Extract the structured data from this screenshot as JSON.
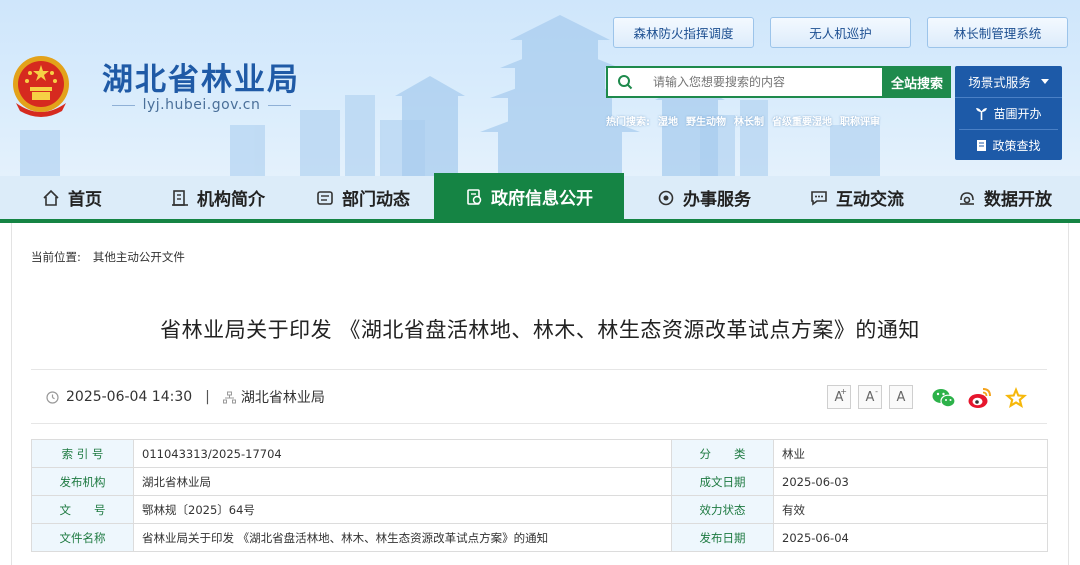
{
  "site": {
    "title": "湖北省林业局",
    "domain": "lyj.hubei.gov.cn"
  },
  "top_links": [
    "森林防火指挥调度",
    "无人机巡护",
    "林长制管理系统"
  ],
  "search": {
    "placeholder": "请输入您想要搜索的内容",
    "button": "全站搜索",
    "hot_label": "热门搜索:",
    "hot_terms": [
      "湿地",
      "野生动物",
      "林长制",
      "省级重要湿地",
      "职称评审"
    ]
  },
  "scene_service": {
    "label": "场景式服务",
    "items": [
      {
        "label": "苗圃开办",
        "icon": "seedling-icon"
      },
      {
        "label": "政策查找",
        "icon": "document-icon"
      }
    ]
  },
  "nav": {
    "items": [
      {
        "label": "首页",
        "icon": "home-icon",
        "active": false
      },
      {
        "label": "机构简介",
        "icon": "building-icon",
        "active": false
      },
      {
        "label": "部门动态",
        "icon": "news-icon",
        "active": false
      },
      {
        "label": "政府信息公开",
        "icon": "info-icon",
        "active": true
      },
      {
        "label": "办事服务",
        "icon": "service-icon",
        "active": false
      },
      {
        "label": "互动交流",
        "icon": "chat-icon",
        "active": false
      },
      {
        "label": "数据开放",
        "icon": "data-icon",
        "active": false
      }
    ]
  },
  "breadcrumb": {
    "label": "当前位置:",
    "path": "其他主动公开文件"
  },
  "article": {
    "title": "省林业局关于印发 《湖北省盘活林地、林木、林生态资源改革试点方案》的通知",
    "datetime": "2025-06-04 14:30",
    "separator": "|",
    "source": "湖北省林业局"
  },
  "font_size_buttons": [
    "A",
    "A",
    "A"
  ],
  "font_size_marks": [
    "+",
    "-",
    ""
  ],
  "share_icons": [
    "wechat-icon",
    "weibo-icon",
    "favorite-star-icon"
  ],
  "info_table": [
    {
      "label1": "索 引 号",
      "value1": "011043313/2025-17704",
      "label2": "分　　类",
      "value2": "林业"
    },
    {
      "label1": "发布机构",
      "value1": "湖北省林业局",
      "label2": "成文日期",
      "value2": "2025-06-03"
    },
    {
      "label1": "文　　号",
      "value1": "鄂林规〔2025〕64号",
      "label2": "效力状态",
      "value2": "有效"
    },
    {
      "label1": "文件名称",
      "value1": "省林业局关于印发 《湖北省盘活林地、林木、林生态资源改革试点方案》的通知",
      "label2": "发布日期",
      "value2": "2025-06-04"
    }
  ],
  "colors": {
    "brand_green": "#158444",
    "brand_blue": "#1d5aa8",
    "title_blue": "#1f5aa6",
    "header_bg": "#d9ecfc"
  }
}
